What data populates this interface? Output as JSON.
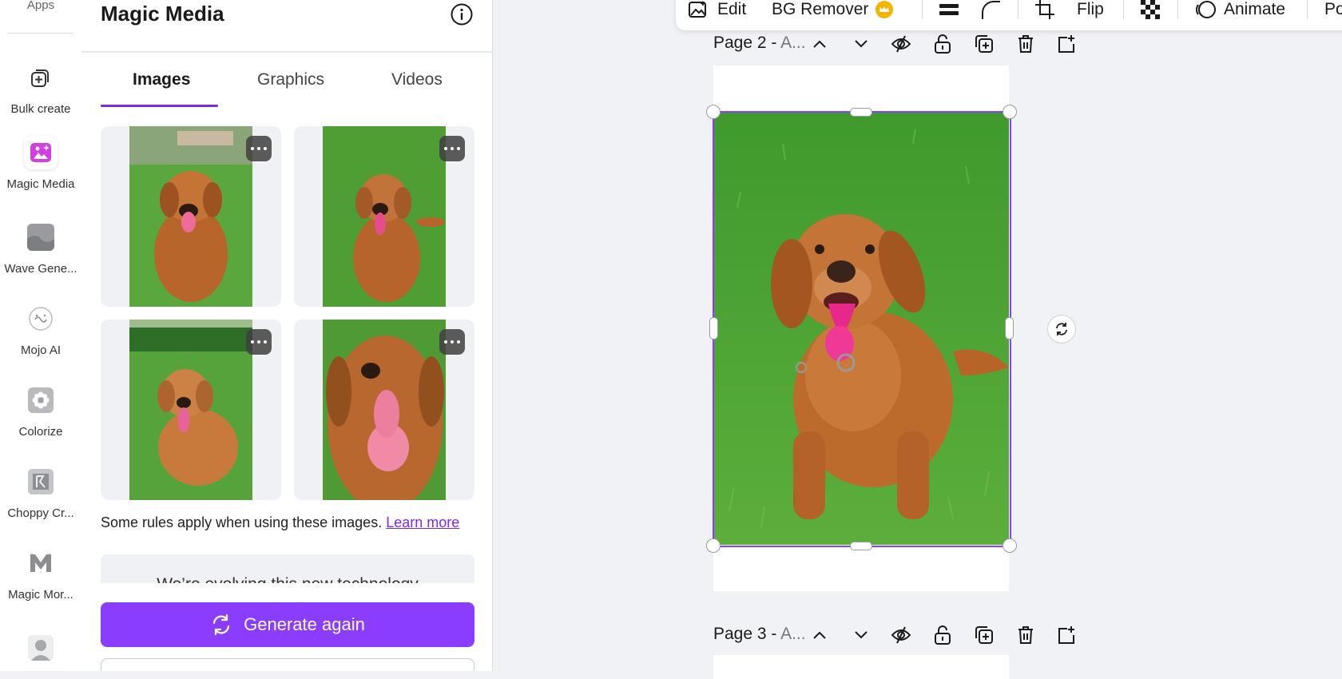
{
  "rail": {
    "apps_label": "Apps",
    "items": [
      {
        "label": "Bulk create",
        "icon": "bulk-create-icon"
      },
      {
        "label": "Magic Media",
        "icon": "magic-media-icon",
        "active": true
      },
      {
        "label": "Wave Gene...",
        "icon": "wave-generator-icon"
      },
      {
        "label": "Mojo AI",
        "icon": "mojo-ai-icon"
      },
      {
        "label": "Colorize",
        "icon": "colorize-icon"
      },
      {
        "label": "Choppy Cr...",
        "icon": "choppy-crop-icon"
      },
      {
        "label": "Magic Mor...",
        "icon": "magic-morph-icon"
      }
    ]
  },
  "panel": {
    "title": "Magic Media",
    "tabs": [
      "Images",
      "Graphics",
      "Videos"
    ],
    "active_tab": "Images",
    "rules_text": "Some rules apply when using these images.",
    "learn_more": "Learn more",
    "evolving_text": "We’re evolving this new technology",
    "generate_button": "Generate again"
  },
  "toolbar": {
    "edit": "Edit",
    "bg_remover": "BG Remover",
    "flip": "Flip",
    "animate": "Animate",
    "position_partial": "Po"
  },
  "pages": [
    {
      "name": "Page 2 - ",
      "suffix": "A..."
    },
    {
      "name": "Page 3 - ",
      "suffix": "A..."
    }
  ],
  "colors": {
    "accent": "#8b3dff",
    "underline": "#7d2ae8",
    "magic_media_icon": "#d23ee0",
    "crown": "#f5b400"
  }
}
